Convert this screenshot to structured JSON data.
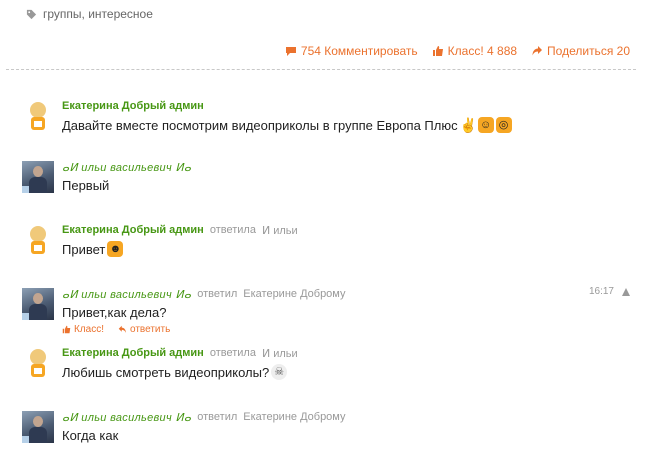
{
  "tags": {
    "text": "группы, интересное"
  },
  "actions": {
    "comment": "754 Комментировать",
    "klass": "Класс! 4 888",
    "share": "Поделиться 20"
  },
  "comments": [
    {
      "author": "Екатерина Добрый админ",
      "reply_prefix": "",
      "reply_target": "",
      "text": "Давайте вместе посмотрим видеоприколы в группе Европа Плюс",
      "emojis": [
        "peace-icon",
        "grin-emoji",
        "glasses-emoji"
      ]
    },
    {
      "author": "ⴰⵍ ильи васильевич ⵍⴰ",
      "reply_prefix": "",
      "reply_target": "",
      "text": "Первый"
    },
    {
      "author": "Екатерина Добрый админ",
      "reply_prefix": "ответила",
      "reply_target": "ⵍ ильи",
      "text": "Привет",
      "emojis": [
        "wink-emoji"
      ]
    },
    {
      "author": "ⴰⵍ ильи васильевич ⵍⴰ",
      "reply_prefix": "ответил",
      "reply_target": "Екатерине Доброму",
      "text": "Привет,как дела?",
      "time": "16:17",
      "sub_actions": {
        "klass": "Класс!",
        "reply": "ответить"
      }
    },
    {
      "author": "Екатерина Добрый админ",
      "reply_prefix": "ответила",
      "reply_target": "ⵍ ильи",
      "text": "Любишь смотреть видеоприколы?",
      "emojis": [
        "ghost-emoji"
      ]
    },
    {
      "author": "ⴰⵍ ильи васильевич ⵍⴰ",
      "reply_prefix": "ответил",
      "reply_target": "Екатерине Доброму",
      "text": "Когда как"
    }
  ],
  "colors": {
    "accent": "#eb722e",
    "author": "#479714",
    "meta": "#999999"
  }
}
